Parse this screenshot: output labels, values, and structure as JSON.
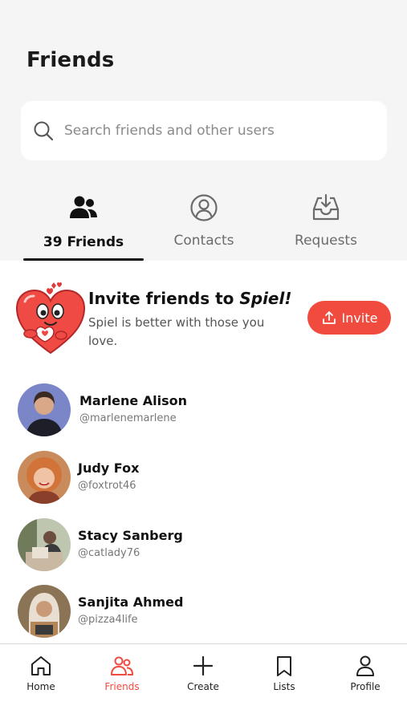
{
  "header": {
    "title": "Friends"
  },
  "search": {
    "placeholder": "Search friends and other users"
  },
  "tabs": [
    {
      "label": "39 Friends",
      "active": true,
      "icon": "people-icon"
    },
    {
      "label": "Contacts",
      "active": false,
      "icon": "contact-icon"
    },
    {
      "label": "Requests",
      "active": false,
      "icon": "inbox-download-icon"
    }
  ],
  "invite": {
    "title_prefix": "Invite friends to ",
    "title_app": "Spiel!",
    "subtitle": "Spiel is better with those you love.",
    "button_label": "Invite"
  },
  "friends": [
    {
      "name": "Marlene Alison",
      "handle": "@marlenemarlene"
    },
    {
      "name": "Judy Fox",
      "handle": "@foxtrot46"
    },
    {
      "name": "Stacy Sanberg",
      "handle": "@catlady76"
    },
    {
      "name": "Sanjita Ahmed",
      "handle": "@pizza4life"
    }
  ],
  "bottom_nav": [
    {
      "label": "Home",
      "icon": "home-icon",
      "active": false
    },
    {
      "label": "Friends",
      "icon": "friends-icon",
      "active": true
    },
    {
      "label": "Create",
      "icon": "plus-icon",
      "active": false
    },
    {
      "label": "Lists",
      "icon": "bookmark-icon",
      "active": false
    },
    {
      "label": "Profile",
      "icon": "person-icon",
      "active": false
    }
  ],
  "colors": {
    "accent": "#f14a3f",
    "background_top": "#f5f5f5",
    "text": "#111111"
  }
}
